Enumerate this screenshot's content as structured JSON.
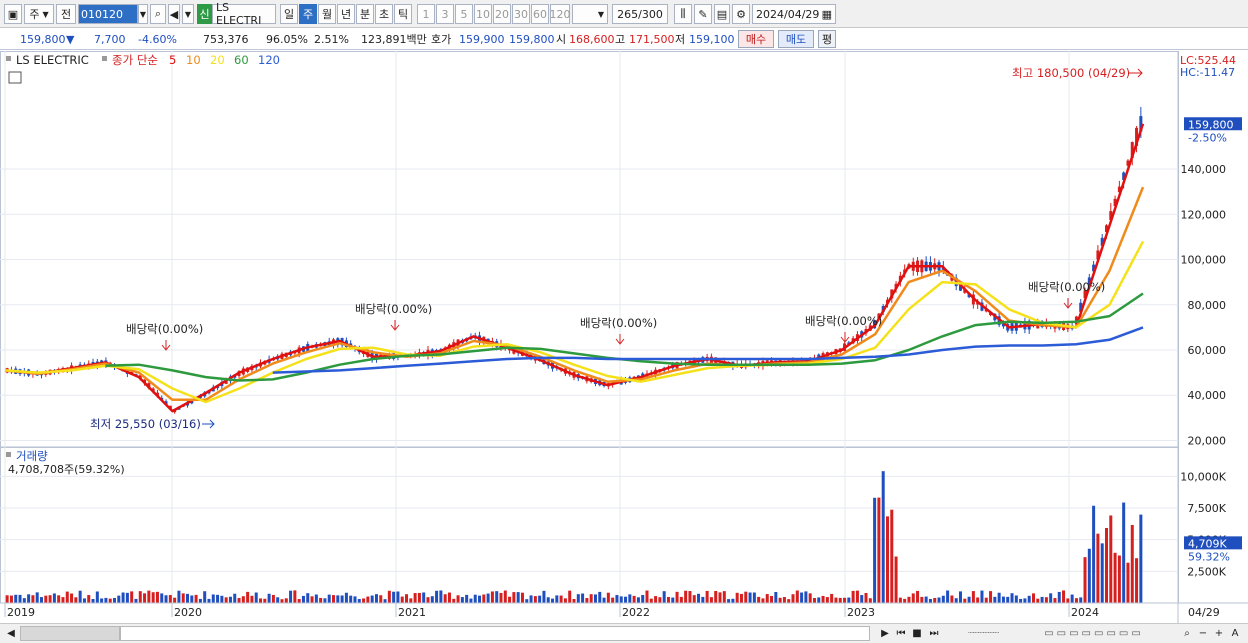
{
  "toolbar": {
    "period_day": "주",
    "prev_label": "전",
    "code": "010120",
    "name_badge": "신",
    "stock_name": "LS ELECTRI",
    "periods": [
      "일",
      "주",
      "월",
      "년",
      "분",
      "초",
      "틱"
    ],
    "active_period": "주",
    "intervals": [
      "1",
      "3",
      "5",
      "10",
      "20",
      "30",
      "60",
      "120"
    ],
    "count": "265",
    "count_total": "/300",
    "date": "2024/04/29"
  },
  "infobar": {
    "price": "159,800",
    "change_arrow": "▼",
    "change": "7,700",
    "change_pct": "-4.60%",
    "volume": "753,376",
    "vol_ratio": "96.05%",
    "turnover": "2.51%",
    "amount": "123,891백만",
    "hoga_label": "호가",
    "ask": "159,900",
    "bid": "159,800",
    "open_label": "시",
    "open": "168,600",
    "high_label": "고",
    "high": "171,500",
    "low_label": "저",
    "low": "159,100",
    "buy_btn": "매수",
    "sell_btn": "매도",
    "eval_btn": "평"
  },
  "legend": {
    "stock": "LS ELECTRIC",
    "ma_label": "종가 단순",
    "ma_periods": [
      "5",
      "10",
      "20",
      "60",
      "120"
    ],
    "lc": "LC:525.44",
    "hc": "HC:-11.47"
  },
  "volume_legend": {
    "title": "거래량",
    "value": "4,708,708주(59.32%)"
  },
  "annotations": {
    "high": "최고 180,500 (04/29)",
    "low": "최저 25,550 (03/16)",
    "dividend": "배당락(0.00%)"
  },
  "price_tag": {
    "value": "159,800",
    "pct": "-2.50%"
  },
  "volume_tag": {
    "value": "4,709K",
    "pct": "59.32%"
  },
  "x_axis": {
    "ticks": [
      "2019",
      "2020",
      "2021",
      "2022",
      "2023",
      "2024"
    ],
    "last": "04/29"
  },
  "colors": {
    "up": "#d62020",
    "down": "#1f4fbf",
    "ma5": "#e01010",
    "ma10": "#f08a1a",
    "ma20": "#f5e11a",
    "ma60": "#2d9a3e",
    "ma120": "#2b5bd6"
  },
  "chart_data": {
    "type": "candlestick",
    "title": "LS ELECTRIC",
    "y_ticks": [
      20000,
      40000,
      60000,
      80000,
      100000,
      120000,
      140000
    ],
    "ylim": [
      18000,
      186000
    ],
    "volume_ticks": [
      "2,500K",
      "5,000K",
      "7,500K",
      "10,000K"
    ],
    "volume_ylim": [
      0,
      12000
    ],
    "grid": true,
    "series": [
      {
        "name": "5",
        "values": [
          51000,
          49500,
          52000,
          54500,
          48000,
          33000,
          41000,
          50000,
          56000,
          61000,
          64000,
          57000,
          57500,
          59500,
          66000,
          61000,
          55500,
          49000,
          44500,
          48000,
          53000,
          56000,
          53000,
          54500,
          55000,
          60000,
          71000,
          97000,
          97000,
          82000,
          70000,
          71500,
          70000,
          115000,
          160000
        ]
      },
      {
        "name": "10",
        "values": [
          51000,
          49500,
          51500,
          54000,
          50000,
          38000,
          38000,
          47000,
          54000,
          59000,
          63000,
          59000,
          57000,
          58500,
          64000,
          62000,
          57000,
          51000,
          46000,
          47000,
          51000,
          54000,
          53000,
          54000,
          54500,
          58000,
          67000,
          90000,
          95000,
          86000,
          73000,
          71000,
          70000,
          95000,
          132000
        ]
      },
      {
        "name": "20",
        "values": [
          51000,
          50000,
          51000,
          53000,
          51500,
          43000,
          37000,
          43000,
          50000,
          56000,
          60500,
          61000,
          58000,
          57500,
          61500,
          62500,
          59000,
          53500,
          48500,
          46000,
          49000,
          52000,
          53000,
          53500,
          54000,
          56000,
          61000,
          78000,
          90000,
          89000,
          78000,
          72000,
          70000,
          80000,
          108000
        ]
      },
      {
        "name": "60",
        "values": [
          null,
          null,
          null,
          53000,
          53500,
          51000,
          48000,
          46500,
          47000,
          50000,
          53500,
          56000,
          57500,
          58000,
          59500,
          61000,
          60500,
          58500,
          56500,
          55000,
          54000,
          53500,
          53500,
          53500,
          53500,
          54000,
          55500,
          60000,
          66000,
          71000,
          72500,
          72000,
          72500,
          75000,
          85000
        ]
      },
      {
        "name": "120",
        "values": [
          null,
          null,
          null,
          null,
          null,
          null,
          null,
          null,
          50000,
          50500,
          51000,
          52000,
          53000,
          54000,
          55000,
          56000,
          56500,
          56500,
          56000,
          56000,
          56000,
          56000,
          56000,
          56000,
          56000,
          56500,
          57000,
          58000,
          60000,
          61500,
          62000,
          62000,
          62500,
          64500,
          70000
        ]
      }
    ],
    "x_ticks": [
      "2019",
      "2020",
      "2021",
      "2022",
      "2023",
      "2024",
      "04/29"
    ],
    "high": 180500,
    "low": 25550,
    "last": 159800
  }
}
